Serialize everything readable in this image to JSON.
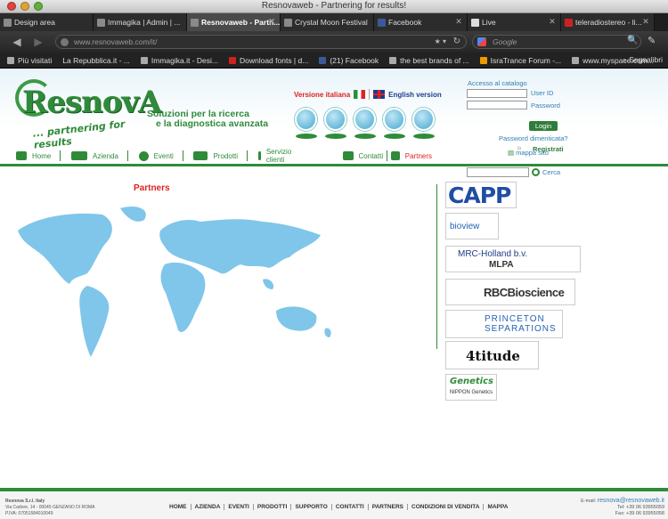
{
  "window": {
    "title": "Resnovaweb - Partnering for results!"
  },
  "tabs": [
    {
      "label": "Design area"
    },
    {
      "label": "Immagika | Admin | ..."
    },
    {
      "label": "Resnovaweb - Partn..."
    },
    {
      "label": "Crystal Moon Festival"
    },
    {
      "label": "Facebook"
    },
    {
      "label": "Live"
    },
    {
      "label": "teleradiostereo - li..."
    }
  ],
  "toolbar": {
    "url": "www.resnovaweb.com/it/",
    "search_placeholder": "Google"
  },
  "bookmarks": {
    "items": [
      {
        "label": "Più visitati"
      },
      {
        "label": "La Repubblica.it - ..."
      },
      {
        "label": "Immagika.it - Desi..."
      },
      {
        "label": "Download fonts | d..."
      },
      {
        "label": "(21) Facebook"
      },
      {
        "label": "the best brands of ..."
      },
      {
        "label": "IsraTrance Forum -..."
      },
      {
        "label": "www.myspace.com..."
      }
    ],
    "right": "Segnalibri"
  },
  "site": {
    "logo": "ResnovA",
    "logo_tag": "... partnering for results",
    "tagline_1": "Soluzioni per la ricerca",
    "tagline_2": "e la diagnostica avanzata",
    "lang_it": "Versione italiana",
    "lang_en": "English version",
    "login": {
      "heading": "Accesso  al catalogo",
      "user_label": "User ID",
      "pass_label": "Password",
      "button": "Login",
      "forgot": "Password dimenticata?",
      "register": "Registrati"
    },
    "mappa": "mappa sito",
    "search_button": "Cerca",
    "nav": [
      {
        "label": "Home"
      },
      {
        "label": "Azienda"
      },
      {
        "label": "Eventi"
      },
      {
        "label": "Prodotti"
      },
      {
        "label": "Servizio clienti"
      },
      {
        "label": "Contatti"
      },
      {
        "label": "Partners"
      }
    ],
    "content_title": "Partners",
    "partners": [
      {
        "name": "CAPP"
      },
      {
        "name": "bioview"
      },
      {
        "name": "MRC-Holland b.v.",
        "sub": "MLPA"
      },
      {
        "name": "RBCBioscience"
      },
      {
        "name": "PRINCETON",
        "sub": "SEPARATIONS"
      },
      {
        "name": "4titude"
      },
      {
        "name": "Genetics",
        "sub": "NIPPON Genetics"
      }
    ],
    "footer": {
      "company": "Resnova S.r.l. Italy",
      "address": "Via Cadore, 14 - 00045 GENZANO DI ROMA",
      "vat": "P.IVA: 07051584010049",
      "links": [
        "HOME",
        "AZIENDA",
        "EVENTI",
        "PRODOTTI",
        "SUPPORTO",
        "CONTATTI",
        "PARTNERS",
        "CONDIZIONI DI VENDITA",
        "MAPPA"
      ],
      "email_label": "E-mail:",
      "email": "resnova@resnovaweb.it",
      "tel": "Tel: +39 06 93955059",
      "fax": "Fax: +39 06 93955058"
    }
  }
}
